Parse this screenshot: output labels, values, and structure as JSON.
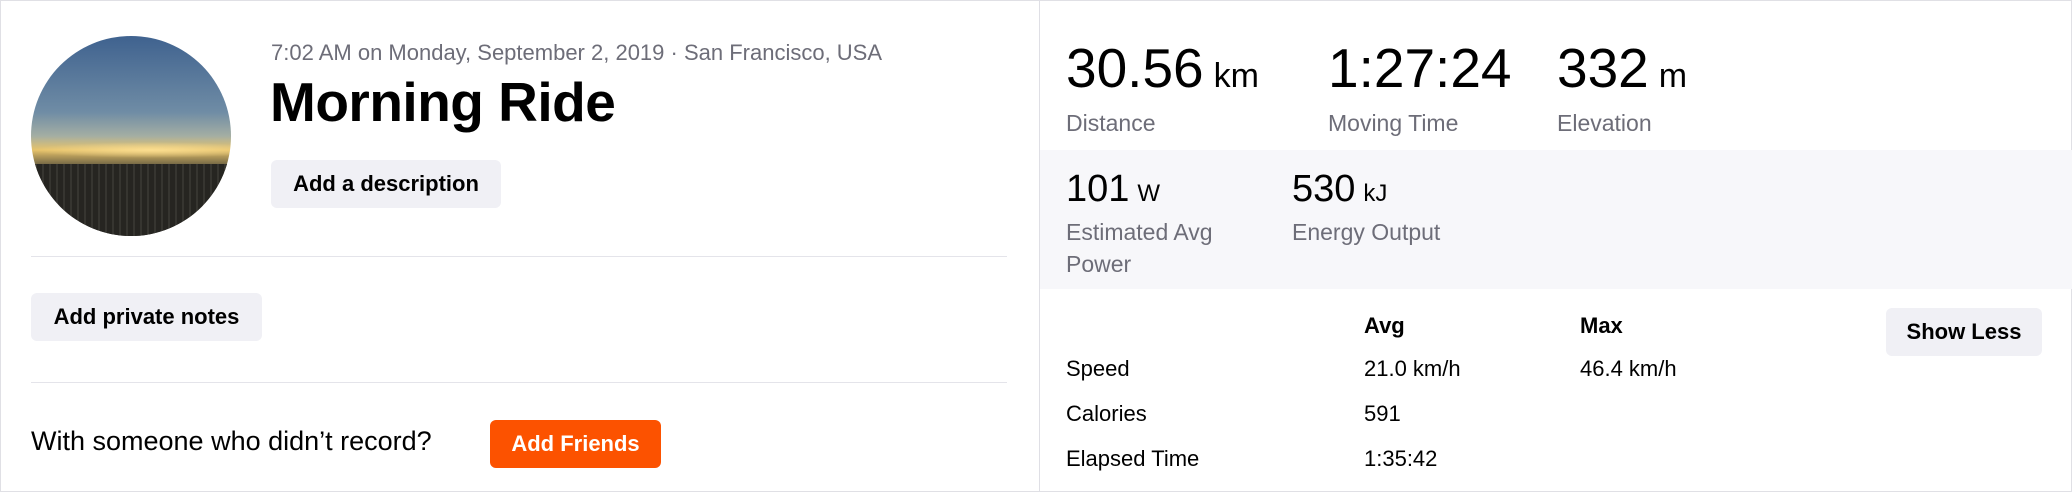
{
  "activity": {
    "meta": "7:02 AM on Monday, September 2, 2019 · San Francisco, USA",
    "title": "Morning Ride",
    "add_description_label": "Add a description",
    "add_private_notes_label": "Add private notes",
    "with_someone_text": "With someone who didn’t record?",
    "add_friends_label": "Add Friends"
  },
  "stats": {
    "primary": [
      {
        "value": "30.56",
        "unit": "km",
        "label": "Distance"
      },
      {
        "value": "1:27:24",
        "unit": "",
        "label": "Moving Time"
      },
      {
        "value": "332",
        "unit": "m",
        "label": "Elevation"
      }
    ],
    "secondary": [
      {
        "value": "101",
        "unit": "W",
        "label": "Estimated Avg Power"
      },
      {
        "value": "530",
        "unit": "kJ",
        "label": "Energy Output"
      }
    ]
  },
  "table": {
    "headers": [
      "",
      "Avg",
      "Max"
    ],
    "rows": [
      {
        "label": "Speed",
        "avg": "21.0 km/h",
        "max": "46.4 km/h"
      },
      {
        "label": "Calories",
        "avg": "591",
        "max": ""
      },
      {
        "label": "Elapsed Time",
        "avg": "1:35:42",
        "max": ""
      }
    ],
    "show_less_label": "Show Less"
  },
  "colors": {
    "accent": "#fc5200",
    "muted": "#6d6d78",
    "band": "#f7f7fa"
  }
}
